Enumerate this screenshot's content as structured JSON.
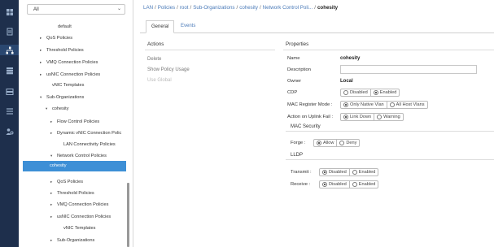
{
  "filter": {
    "value": "All"
  },
  "tree": [
    {
      "label": "default",
      "toggle": ""
    },
    {
      "label": "QoS Policies",
      "toggle": "▸"
    },
    {
      "label": "Threshold Policies",
      "toggle": "▸"
    },
    {
      "label": "VMQ Connection Policies",
      "toggle": "▸"
    },
    {
      "label": "usNIC Connection Policies",
      "toggle": "▸"
    },
    {
      "label": "vNIC Templates",
      "toggle": ""
    },
    {
      "label": "Sub-Organizations",
      "toggle": "▾"
    },
    {
      "label": "cohesity",
      "toggle": "▾"
    },
    {
      "label": "Flow Control Policies",
      "toggle": "▸"
    },
    {
      "label": "Dynamic vNIC Connection Polic",
      "toggle": "▸"
    },
    {
      "label": "LAN Connectivity Policies",
      "toggle": ""
    },
    {
      "label": "Network Control Policies",
      "toggle": "▾"
    },
    {
      "label": "cohesity",
      "toggle": ""
    },
    {
      "label": "QoS Policies",
      "toggle": "▸"
    },
    {
      "label": "Threshold Policies",
      "toggle": "▸"
    },
    {
      "label": "VMQ Connection Policies",
      "toggle": "▸"
    },
    {
      "label": "usNIC Connection Policies",
      "toggle": "▸"
    },
    {
      "label": "vNIC Templates",
      "toggle": ""
    },
    {
      "label": "Sub-Organizations",
      "toggle": "▸"
    }
  ],
  "breadcrumb": {
    "items": [
      "LAN",
      "Policies",
      "root",
      "Sub-Organizations",
      "cohesity",
      "Network Control Poli..."
    ],
    "current": "cohesity",
    "sep": "/"
  },
  "tabs": [
    "General",
    "Events"
  ],
  "actions": {
    "heading": "Actions",
    "items": [
      "Delete",
      "Show Policy Usage",
      "Use Global"
    ]
  },
  "properties": {
    "heading": "Properties",
    "name_label": "Name",
    "name_value": "cohesity",
    "description_label": "Description",
    "owner_label": "Owner",
    "owner_value": "Local",
    "cdp_label": "CDP",
    "cdp_options": [
      "Disabled",
      "Enabled"
    ],
    "mac_register_label": "MAC Register Mode :",
    "mac_register_options": [
      "Only Native Vlan",
      "All Host Vlans"
    ],
    "uplink_fail_label": "Action on Uplink Fail :",
    "uplink_fail_options": [
      "Link Down",
      "Warning"
    ],
    "mac_security_heading": "MAC Security",
    "forge_label": "Forge :",
    "forge_options": [
      "Allow",
      "Deny"
    ],
    "lldp_heading": "LLDP",
    "transmit_label": "Transmit :",
    "transmit_options": [
      "Disabled",
      "Enabled"
    ],
    "receive_label": "Receive :",
    "receive_options": [
      "Disabled",
      "Enabled"
    ]
  }
}
